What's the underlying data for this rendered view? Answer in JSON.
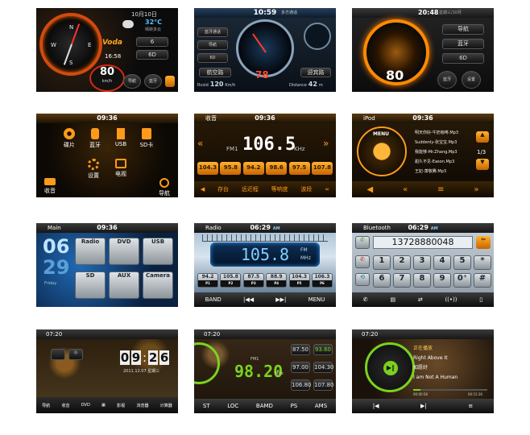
{
  "t1": {
    "date": "10月10日",
    "weather": "32°C",
    "weather_sub": "晴转多云",
    "time": "16:58",
    "brand": "Voda",
    "speed": "80",
    "unit": "km/h",
    "dial_letters": [
      "N",
      "E",
      "S",
      "W"
    ],
    "btn_a": "6",
    "btn_b": "6D",
    "btn_c": "导航",
    "btn_d": "蓝牙"
  },
  "t2": {
    "time": "10:59",
    "status": "多方通话",
    "side": [
      "蓝牙通话",
      "导航",
      "6D"
    ],
    "left_btn": "航空路",
    "right_btn": "迎宾路",
    "dist_left_label": "Rcoid",
    "dist_left": "120",
    "dist_left_unit": "Km/h",
    "speed": "78",
    "dist_right_label": "Distance",
    "dist_right": "42",
    "dist_right_unit": "m"
  },
  "t3": {
    "time": "20:48",
    "date": "星期三/10月",
    "speed": "80",
    "buttons": [
      "导航",
      "蓝牙",
      "6D"
    ],
    "round_a": "蓝牙",
    "round_b": "设置"
  },
  "t4": {
    "time": "09:36",
    "items": [
      "碟片",
      "蓝牙",
      "USB",
      "SD卡",
      "设置",
      "电视"
    ],
    "bottom_left": "收音",
    "bottom_right": "导航"
  },
  "t5": {
    "title": "收音",
    "time": "09:36",
    "band": "FM1",
    "freq": "106.5",
    "unit": "KHz",
    "presets": [
      "104.3",
      "95.8",
      "94.2",
      "98.6",
      "97.5",
      "107.8"
    ],
    "preset_unit": "KHz",
    "bottom": [
      "存台",
      "远近程",
      "等响度",
      "波段"
    ]
  },
  "t6": {
    "title": "iPod",
    "time": "09:36",
    "menu": "MENU",
    "tracks": [
      "明天你好-牛奶咖啡.Mp3",
      "Suddenly-张宝宝.Mp3",
      "我能够-Mr.Zhang.Mp3",
      "甜久不见-Eason.Mp3",
      "王妃-萧敬腾.Mp3"
    ],
    "page": "1/3"
  },
  "t7": {
    "title": "Main",
    "time": "09:36",
    "big_clock": "06",
    "big_clock2": "29",
    "date": "Friday",
    "apps": [
      "Radio",
      "DVD",
      "USB",
      "SD",
      "AUX",
      "Camera"
    ]
  },
  "t8": {
    "title": "Radio",
    "time": "06:29",
    "ampm": "AM",
    "freq": "105.8",
    "band": "FM",
    "unit": "MHz",
    "presets": [
      {
        "f": "94.2",
        "p": "P1"
      },
      {
        "f": "105.8",
        "p": "P2"
      },
      {
        "f": "87.5",
        "p": "P3"
      },
      {
        "f": "88.9",
        "p": "P4"
      },
      {
        "f": "104.3",
        "p": "P5"
      },
      {
        "f": "106.3",
        "p": "P6"
      }
    ],
    "band_btn": "BAND",
    "menu_btn": "MENU"
  },
  "t9": {
    "title": "Bluetooth",
    "time": "06:29",
    "ampm": "AM",
    "number": "13728880048",
    "keys": [
      "1",
      "2",
      "3",
      "4",
      "5",
      "*",
      "6",
      "7",
      "8",
      "9",
      "0⁺",
      "#"
    ]
  },
  "t10": {
    "time": "07:20",
    "clock": [
      "0",
      "9",
      "2",
      "6"
    ],
    "date": "2011.12.07  星期三",
    "dock": [
      "导航",
      "收音",
      "DVD",
      "",
      "影视",
      "浏览器",
      "计算器"
    ]
  },
  "t11": {
    "time": "07:20",
    "band": "FM1",
    "freq": "98.20",
    "unit": "MHz",
    "presets": [
      "87.50",
      "93.60",
      "97.00",
      "104.30",
      "106.80",
      "107.80"
    ],
    "bottom": [
      "ST",
      "LOC",
      "BAMD",
      "PS",
      "AMS"
    ]
  },
  "t12": {
    "time": "07:20",
    "header": "正在播放",
    "song1": "Right Above It",
    "song2": "如愿好",
    "song3": "I am Not A Human",
    "t_start": "00:00:58",
    "t_end": "00:15:36"
  },
  "colors": {
    "orange": "#ff9a1a",
    "blue": "#3fb4ff",
    "green": "#7ad21f",
    "red": "#d72020"
  }
}
